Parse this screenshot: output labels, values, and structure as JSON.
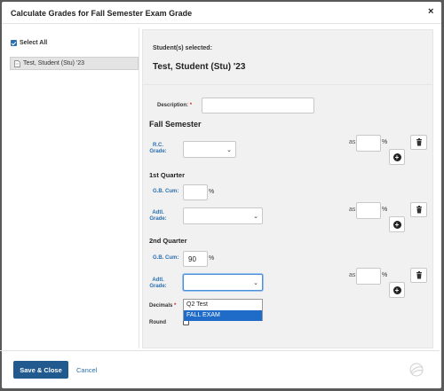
{
  "dialog": {
    "title": "Calculate Grades for Fall Semester Exam Grade",
    "close_label": "×"
  },
  "left": {
    "select_all_label": "Select All",
    "students": [
      {
        "name": "Test, Student (Stu) '23",
        "selected": true
      }
    ]
  },
  "selected": {
    "label": "Student(s) selected:",
    "name": "Test, Student (Stu) '23"
  },
  "form": {
    "description_label": "Description:",
    "description_value": "",
    "fall_semester": {
      "heading": "Fall Semester",
      "rc_grade_label": "R.C. Grade:",
      "rc_grade_value": "",
      "as_label": "as",
      "weight_value": "",
      "pct": "%"
    },
    "q1": {
      "heading": "1st Quarter",
      "gb_cum_label": "G.B. Cum:",
      "gb_cum_value": "",
      "pct": "%",
      "adtl_grade_label": "Adtl. Grade:",
      "adtl_grade_value": "",
      "as_label": "as",
      "weight_value": "",
      "weight_pct": "%"
    },
    "q2": {
      "heading": "2nd Quarter",
      "gb_cum_label": "G.B. Cum:",
      "gb_cum_value": "90",
      "pct": "%",
      "adtl_grade_label": "Adtl. Grade:",
      "adtl_grade_value": "",
      "adtl_grade_options": [
        "Q2 Test",
        "FALL EXAM"
      ],
      "highlighted_option": "FALL EXAM",
      "as_label": "as",
      "weight_value": "",
      "weight_pct": "%"
    },
    "decimals_label": "Decimals",
    "round_label": "Round",
    "round_checked": false
  },
  "footer": {
    "save_label": "Save & Close",
    "cancel_label": "Cancel"
  },
  "colors": {
    "primary": "#215a8e",
    "link": "#2a6fb0",
    "highlight": "#1e6cc8",
    "required": "#c62828"
  },
  "icons": [
    "close-icon",
    "checkbox-icon",
    "document-icon",
    "trash-icon",
    "plus-circle-icon",
    "chevron-down-icon",
    "watermark-logo-icon"
  ]
}
